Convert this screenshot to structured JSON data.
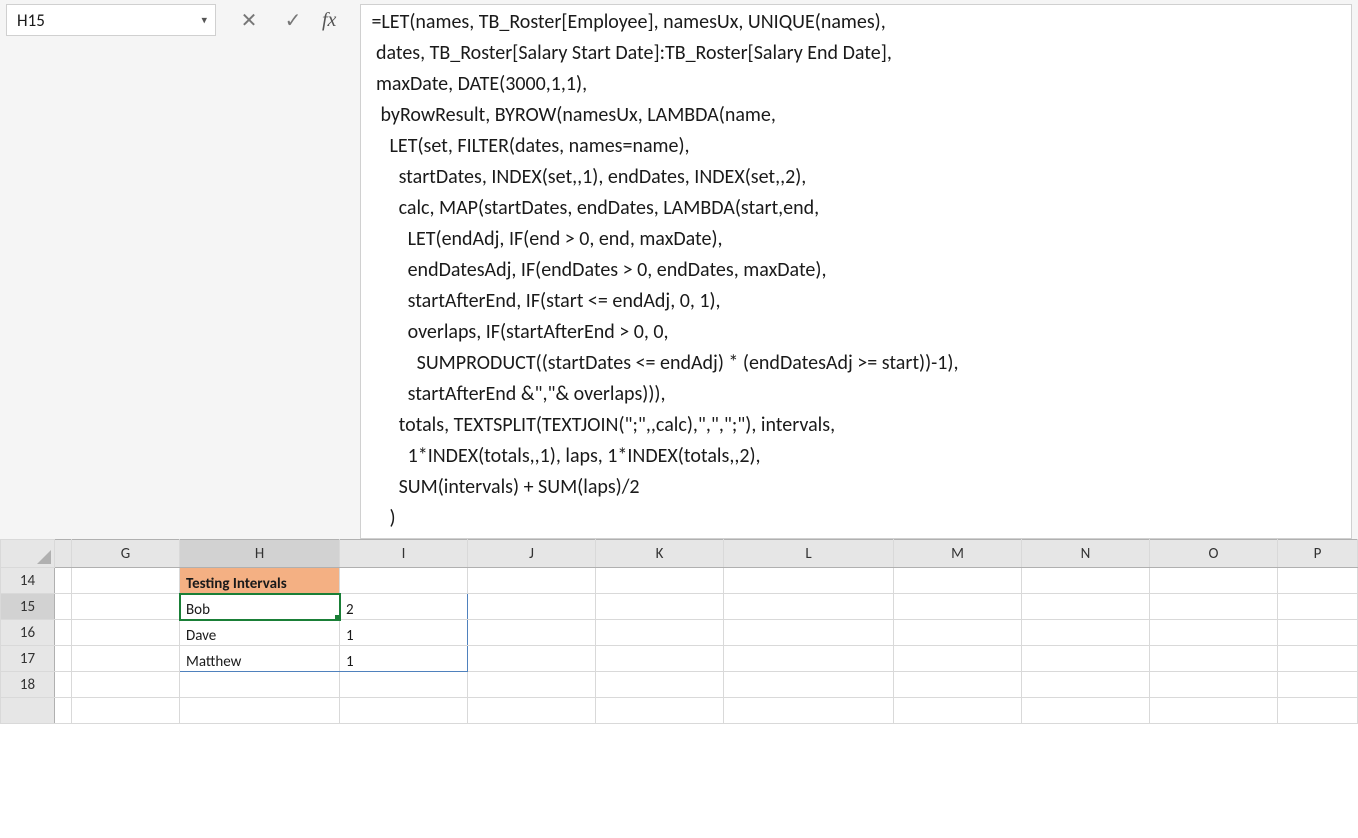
{
  "name_box": {
    "value": "H15"
  },
  "fx": {
    "cancel_glyph": "✕",
    "enter_glyph": "✓",
    "label": "fx"
  },
  "formula": "=LET(names, TB_Roster[Employee], namesUx, UNIQUE(names),\n dates, TB_Roster[Salary Start Date]:TB_Roster[Salary End Date],\n maxDate, DATE(3000,1,1),\n  byRowResult, BYROW(namesUx, LAMBDA(name,\n    LET(set, FILTER(dates, names=name),\n      startDates, INDEX(set,,1), endDates, INDEX(set,,2),\n      calc, MAP(startDates, endDates, LAMBDA(start,end,\n        LET(endAdj, IF(end > 0, end, maxDate),\n        endDatesAdj, IF(endDates > 0, endDates, maxDate),\n        startAfterEnd, IF(start <= endAdj, 0, 1),\n        overlaps, IF(startAfterEnd > 0, 0,\n          SUMPRODUCT((startDates <= endAdj) * (endDatesAdj >= start))-1),\n        startAfterEnd &\",\"& overlaps))),\n      totals, TEXTSPLIT(TEXTJOIN(\";\",,calc),\",\",\";\"), intervals,\n        1*INDEX(totals,,1), laps, 1*INDEX(totals,,2),\n      SUM(intervals) + SUM(laps)/2\n    )",
  "columns": [
    "G",
    "H",
    "I",
    "J",
    "K",
    "L",
    "M",
    "N",
    "O",
    "P"
  ],
  "row_start": 14,
  "active_cell": {
    "col": "H",
    "row": 15
  },
  "cells": {
    "H14": {
      "text": "Testing Intervals",
      "header": true
    },
    "H15": {
      "text": "Bob"
    },
    "I15": {
      "text": "2",
      "num": true
    },
    "H16": {
      "text": "Dave"
    },
    "I16": {
      "text": "1",
      "num": true
    },
    "H17": {
      "text": "Matthew"
    },
    "I17": {
      "text": "1",
      "num": true
    }
  }
}
